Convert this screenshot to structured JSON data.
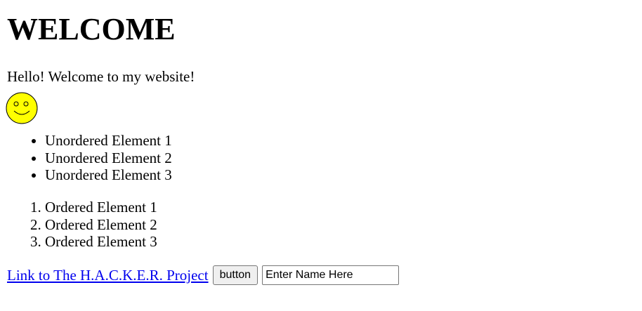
{
  "heading": "WELCOME",
  "intro": "Hello! Welcome to my website!",
  "smiley": {
    "icon": "smiley-face-icon",
    "fill": "#ffff00",
    "stroke": "#000000"
  },
  "unordered_list": [
    "Unordered Element 1",
    "Unordered Element 2",
    "Unordered Element 3"
  ],
  "ordered_list": [
    "Ordered Element 1",
    "Ordered Element 2",
    "Ordered Element 3"
  ],
  "controls": {
    "link_text": "Link to The H.A.C.K.E.R. Project",
    "button_label": "button",
    "name_input_value": "Enter Name Here"
  },
  "colors": {
    "link": "#0000ee"
  }
}
